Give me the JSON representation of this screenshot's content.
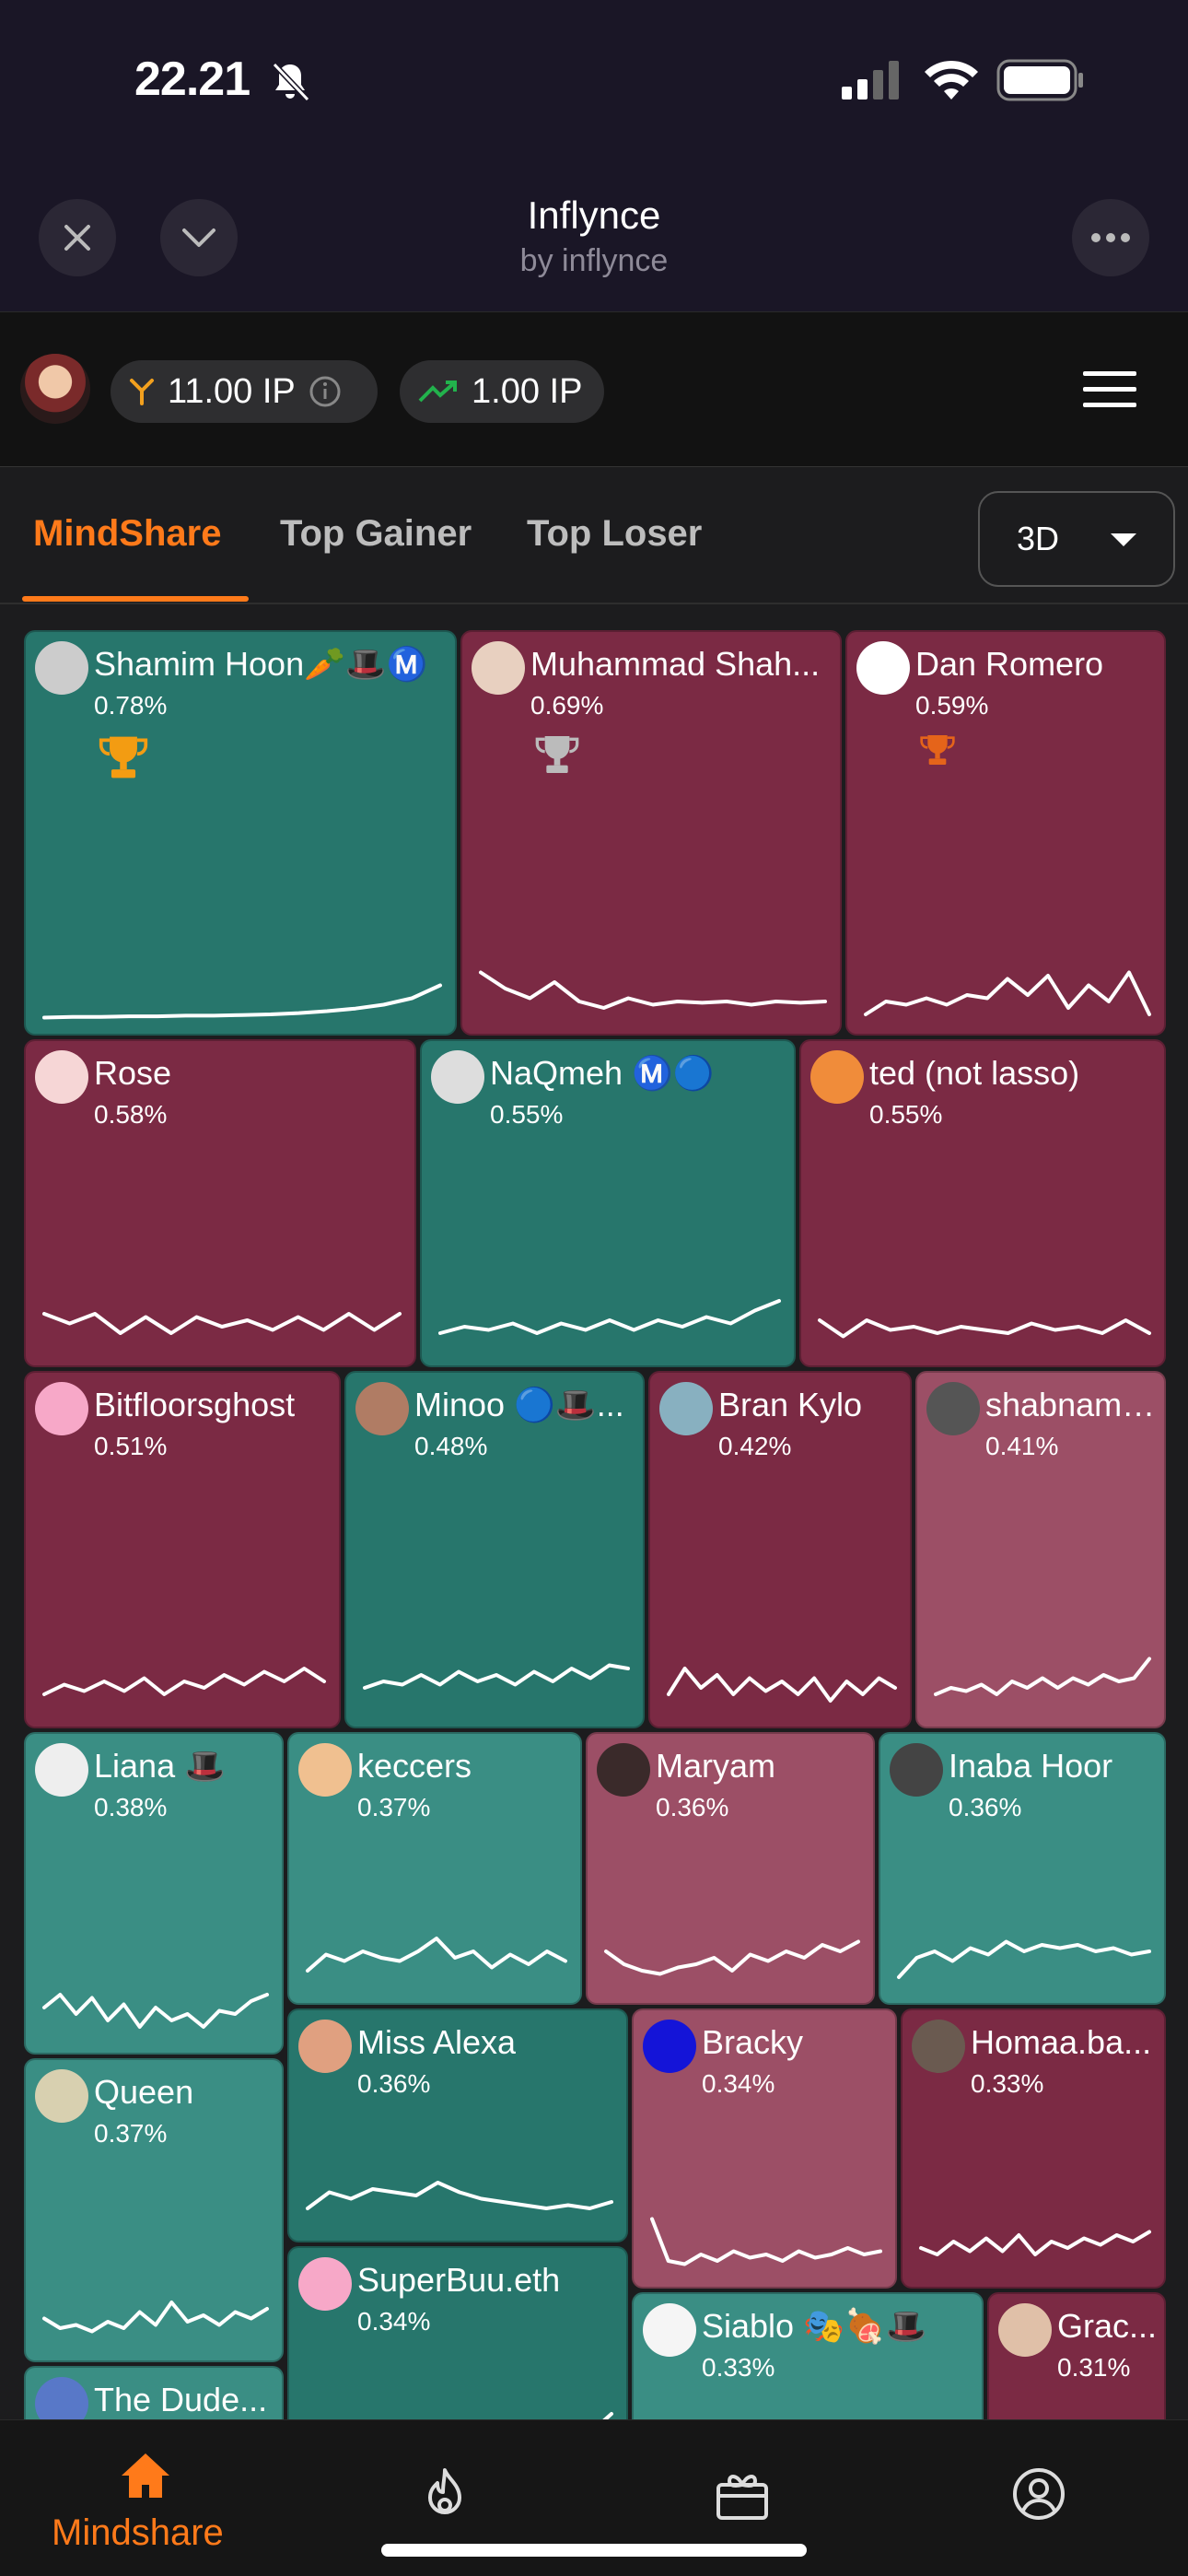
{
  "status_bar": {
    "time": "22.21"
  },
  "app": {
    "title": "Inflynce",
    "subtitle": "by inflynce"
  },
  "points": {
    "ip_value": "11.00 IP",
    "gain_value": "1.00 IP"
  },
  "tabs": {
    "mindshare": "MindShare",
    "top_gainer": "Top Gainer",
    "top_loser": "Top Loser"
  },
  "range_select": {
    "selected": "3D"
  },
  "colors": {
    "green": "#27766c",
    "green_light": "#3a8e84",
    "red": "#7b2a44",
    "red_light": "#9c4f66",
    "accent": "#ff7a1a"
  },
  "tiles": [
    {
      "name": "Shamim Hoon🥕🎩Ⓜ️",
      "pct": "0.78%",
      "trend": [
        0.05,
        0.06,
        0.06,
        0.07,
        0.07,
        0.08,
        0.08,
        0.09,
        0.1,
        0.12,
        0.15,
        0.19,
        0.25,
        0.35,
        0.55
      ]
    },
    {
      "name": "Muhammad Shah...",
      "pct": "0.69%",
      "trend": [
        0.75,
        0.5,
        0.35,
        0.6,
        0.3,
        0.2,
        0.35,
        0.25,
        0.3,
        0.28,
        0.3,
        0.25,
        0.3,
        0.28,
        0.3
      ]
    },
    {
      "name": "Dan Romero",
      "pct": "0.59%",
      "trend": [
        0.1,
        0.3,
        0.25,
        0.35,
        0.25,
        0.4,
        0.35,
        0.65,
        0.4,
        0.7,
        0.2,
        0.55,
        0.3,
        0.75,
        0.1
      ]
    },
    {
      "name": "Rose",
      "pct": "0.58%",
      "trend": [
        0.6,
        0.45,
        0.6,
        0.3,
        0.55,
        0.3,
        0.55,
        0.4,
        0.5,
        0.35,
        0.55,
        0.35,
        0.6,
        0.35,
        0.6
      ]
    },
    {
      "name": "NaQmeh Ⓜ️🔵",
      "pct": "0.55%",
      "trend": [
        0.3,
        0.4,
        0.35,
        0.45,
        0.3,
        0.45,
        0.35,
        0.5,
        0.35,
        0.5,
        0.4,
        0.55,
        0.45,
        0.65,
        0.8
      ]
    },
    {
      "name": "ted (not lasso)",
      "pct": "0.55%",
      "trend": [
        0.5,
        0.25,
        0.5,
        0.35,
        0.4,
        0.3,
        0.4,
        0.35,
        0.3,
        0.45,
        0.35,
        0.4,
        0.3,
        0.5,
        0.3
      ]
    },
    {
      "name": "Bitfloorsghost",
      "pct": "0.51%",
      "trend": [
        0.3,
        0.45,
        0.35,
        0.5,
        0.35,
        0.55,
        0.3,
        0.5,
        0.4,
        0.6,
        0.45,
        0.65,
        0.5,
        0.7,
        0.5
      ]
    },
    {
      "name": "Minoo 🔵🎩...",
      "pct": "0.48%",
      "trend": [
        0.4,
        0.5,
        0.45,
        0.6,
        0.45,
        0.65,
        0.5,
        0.6,
        0.45,
        0.65,
        0.5,
        0.7,
        0.55,
        0.75,
        0.7
      ]
    },
    {
      "name": "Bran Kylo",
      "pct": "0.42%",
      "trend": [
        0.3,
        0.7,
        0.4,
        0.6,
        0.3,
        0.55,
        0.35,
        0.5,
        0.3,
        0.55,
        0.2,
        0.5,
        0.3,
        0.55,
        0.4
      ]
    },
    {
      "name": "shabnampo",
      "pct": "0.41%",
      "trend": [
        0.3,
        0.4,
        0.35,
        0.45,
        0.3,
        0.5,
        0.4,
        0.55,
        0.4,
        0.55,
        0.45,
        0.6,
        0.5,
        0.55,
        0.85
      ]
    },
    {
      "name": "Liana 🎩",
      "pct": "0.38%",
      "trend": [
        0.5,
        0.7,
        0.4,
        0.65,
        0.3,
        0.55,
        0.2,
        0.5,
        0.3,
        0.4,
        0.2,
        0.45,
        0.4,
        0.6,
        0.7
      ]
    },
    {
      "name": "keccers",
      "pct": "0.37%",
      "trend": [
        0.3,
        0.55,
        0.45,
        0.6,
        0.5,
        0.45,
        0.6,
        0.8,
        0.5,
        0.6,
        0.35,
        0.55,
        0.4,
        0.6,
        0.45
      ]
    },
    {
      "name": "Maryam",
      "pct": "0.36%",
      "trend": [
        0.6,
        0.4,
        0.3,
        0.25,
        0.35,
        0.4,
        0.5,
        0.3,
        0.55,
        0.45,
        0.6,
        0.5,
        0.7,
        0.6,
        0.75
      ]
    },
    {
      "name": "Inaba Hoor",
      "pct": "0.36%",
      "trend": [
        0.2,
        0.5,
        0.6,
        0.45,
        0.65,
        0.55,
        0.75,
        0.6,
        0.7,
        0.65,
        0.7,
        0.6,
        0.65,
        0.55,
        0.6
      ]
    },
    {
      "name": "Queen",
      "pct": "0.37%",
      "trend": [
        0.45,
        0.3,
        0.35,
        0.25,
        0.4,
        0.3,
        0.55,
        0.35,
        0.7,
        0.4,
        0.5,
        0.35,
        0.55,
        0.45,
        0.6
      ]
    },
    {
      "name": "Miss Alexa",
      "pct": "0.36%",
      "trend": [
        0.3,
        0.55,
        0.45,
        0.6,
        0.55,
        0.5,
        0.7,
        0.55,
        0.45,
        0.4,
        0.35,
        0.3,
        0.35,
        0.3,
        0.4
      ]
    },
    {
      "name": "Bracky",
      "pct": "0.34%",
      "trend": [
        0.85,
        0.2,
        0.15,
        0.3,
        0.2,
        0.35,
        0.25,
        0.3,
        0.2,
        0.35,
        0.25,
        0.3,
        0.4,
        0.3,
        0.35
      ]
    },
    {
      "name": "Homaa.ba...",
      "pct": "0.33%",
      "trend": [
        0.4,
        0.3,
        0.5,
        0.35,
        0.55,
        0.35,
        0.6,
        0.3,
        0.5,
        0.4,
        0.55,
        0.45,
        0.6,
        0.5,
        0.65
      ]
    },
    {
      "name": "SuperBuu.eth",
      "pct": "0.34%",
      "trend": [
        0.1,
        0.1,
        0.1,
        0.1,
        0.1,
        0.1,
        0.1,
        0.1,
        0.1,
        0.1,
        0.1,
        0.1,
        0.1,
        0.3,
        0.6
      ]
    },
    {
      "name": "Siablo 🎭🍖🎩",
      "pct": "0.33%",
      "trend": []
    },
    {
      "name": "Grac...",
      "pct": "0.31%",
      "trend": []
    },
    {
      "name": "The Dude...",
      "pct": "",
      "trend": []
    }
  ],
  "nav": {
    "mindshare_label": "Mindshare"
  }
}
